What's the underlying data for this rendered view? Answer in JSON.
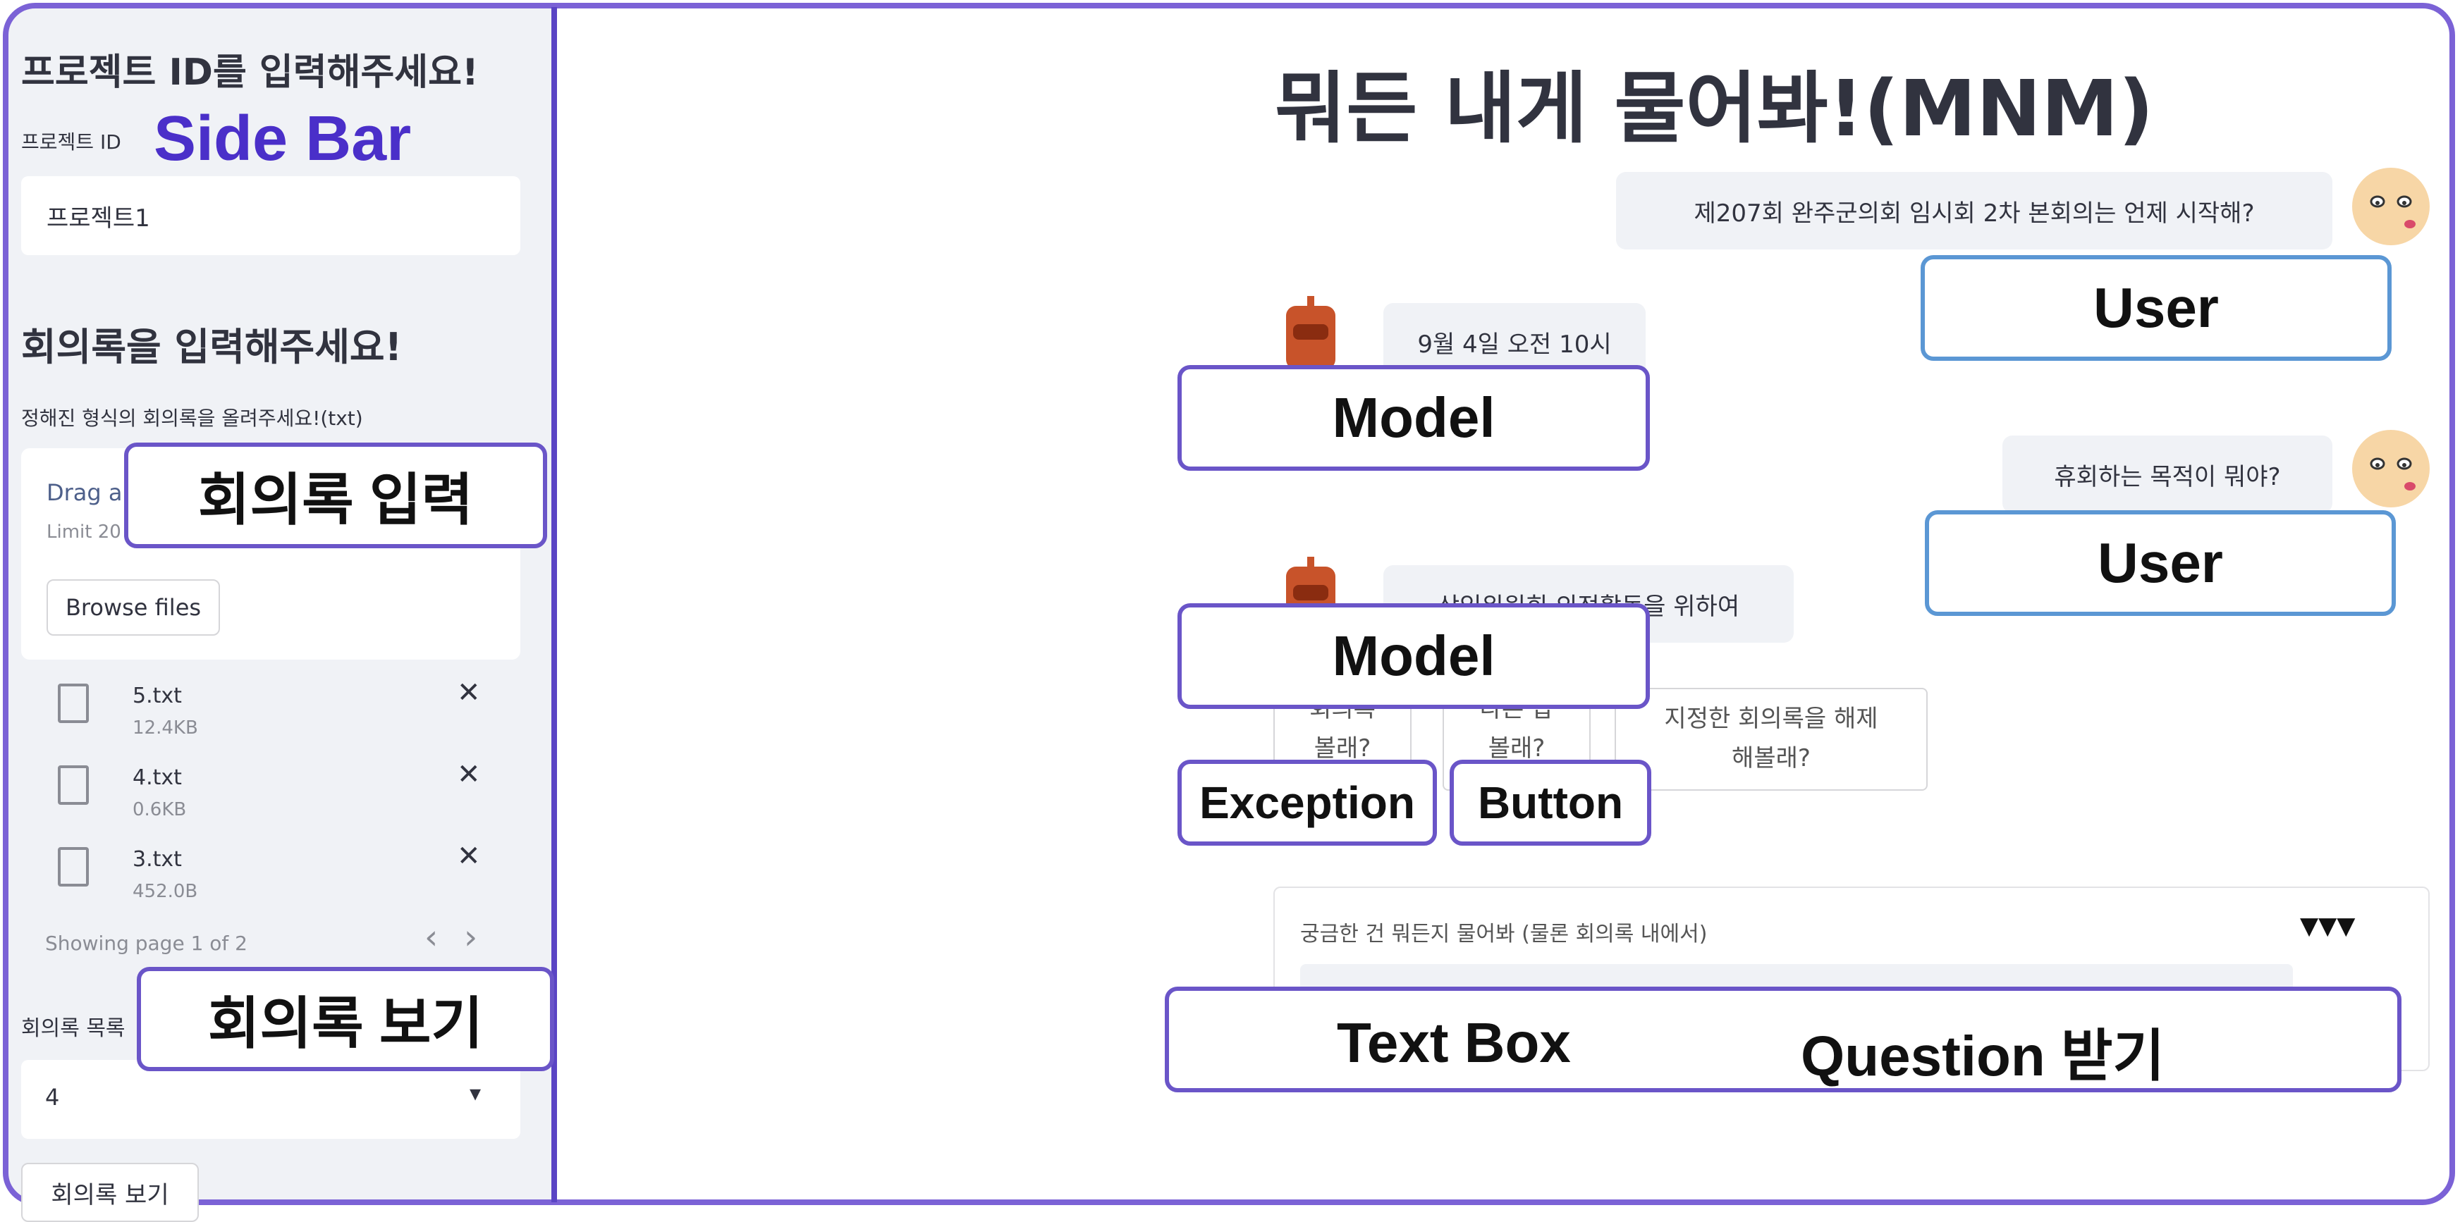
{
  "sidebar": {
    "project_heading": "프로젝트 ID를 입력해주세요!",
    "project_label": "프로젝트 ID",
    "side_bar_annotation": "Side Bar",
    "project_input_value": "프로젝트1",
    "minutes_heading": "회의록을 입력해주세요!",
    "minutes_caption": "정해진 형식의 회의록을 올려주세요!(txt)",
    "dropzone_title": "Drag ar",
    "dropzone_limit": "Limit 20",
    "browse_button": "Browse files",
    "files": [
      {
        "name": "5.txt",
        "size": "12.4KB"
      },
      {
        "name": "4.txt",
        "size": "0.6KB"
      },
      {
        "name": "3.txt",
        "size": "452.0B"
      }
    ],
    "pagination_text": "Showing page 1 of 2",
    "prev_icon": "‹",
    "next_icon": "›",
    "close_icon": "✕",
    "upload_annotation": "회의록 입력",
    "select_label": "회의록 목록",
    "select_value": "4",
    "select_caret": "▾",
    "view_annotation": "회의록 보기",
    "view_button": "회의록 보기"
  },
  "main": {
    "title": "뭐든 내게 물어봐!(MNM)",
    "messages": [
      {
        "role": "user",
        "text": "제207회 완주군의회 임시회 2차 본회의는 언제 시작해?"
      },
      {
        "role": "assistant",
        "text": "9월 4일 오전 10시"
      },
      {
        "role": "user",
        "text": "휴회하는 목적이 뭐야?"
      },
      {
        "role": "assistant",
        "text": "상임위원회 의정활동을 위하여"
      }
    ],
    "annotations": {
      "user": "User",
      "model": "Model",
      "exception": "Exception",
      "button": "Button",
      "text_box": "Text Box",
      "question": "Question 받기"
    },
    "action_buttons": [
      {
        "line1": "회의록",
        "line2": "볼래?"
      },
      {
        "line1": "다른 답",
        "line2": "볼래?"
      },
      {
        "line1": "지정한 회의록을 해제",
        "line2": "해볼래?"
      }
    ],
    "input_label": "궁금한 건 뭐든지 물어봐 (물론 회의록 내에서)",
    "input_toggle": "▼▼▼"
  },
  "colors": {
    "frame": "#7b62d6",
    "annotation_purple": "#6a55c8",
    "annotation_blue": "#5b97d4",
    "side_bar_text": "#4a2fc9",
    "sidebar_bg": "#f0f2f6"
  }
}
